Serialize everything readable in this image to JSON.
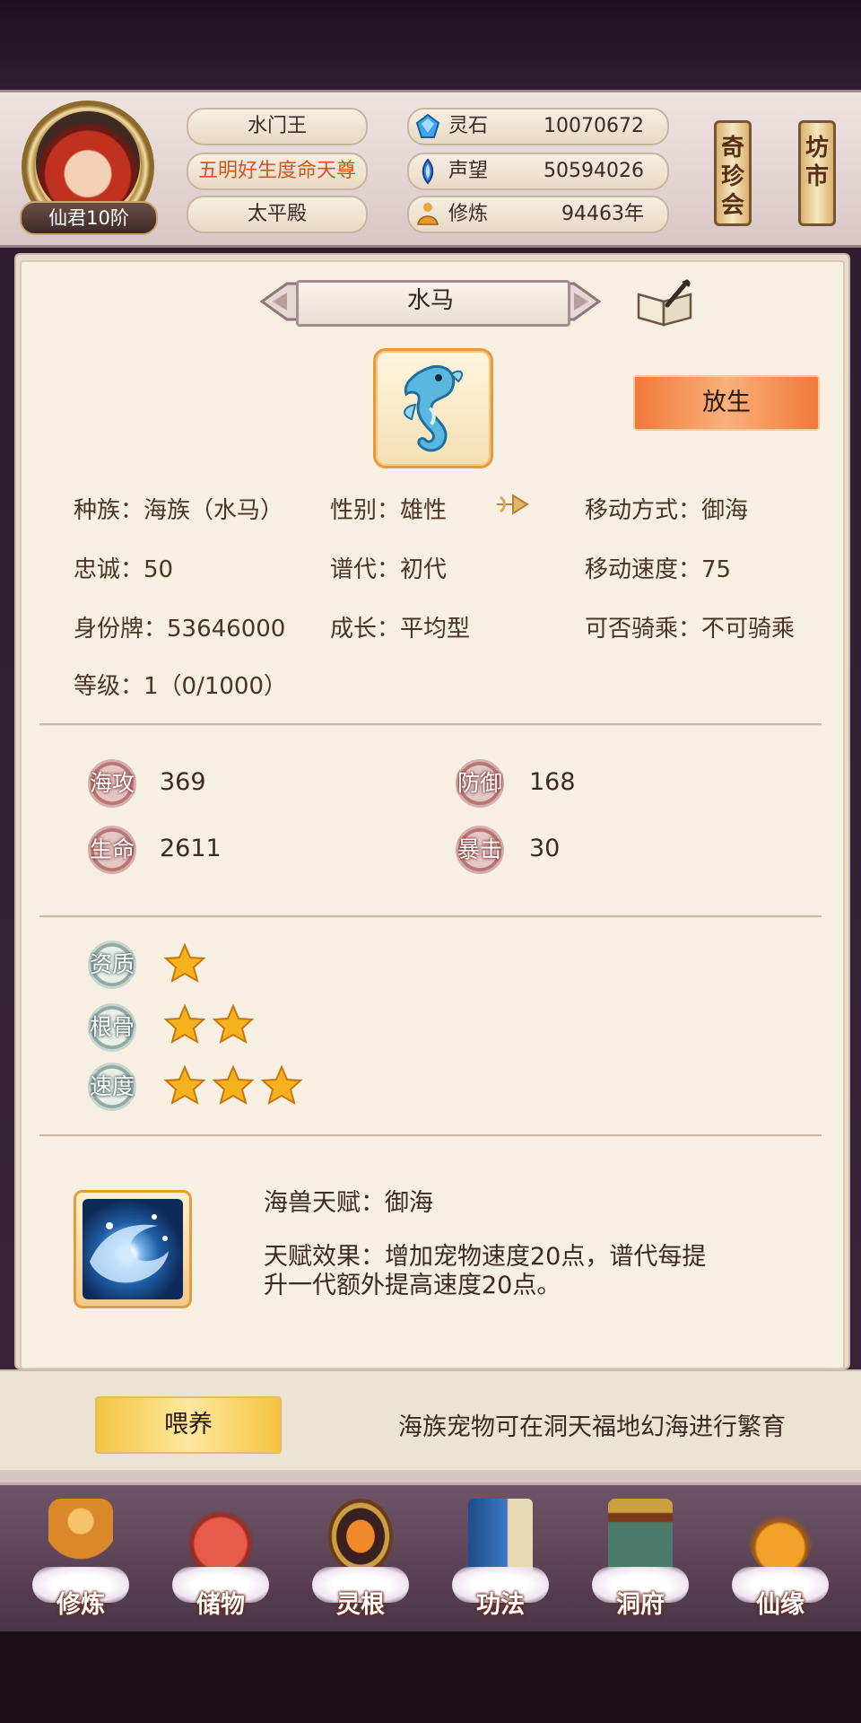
{
  "header": {
    "rank": "仙君10阶",
    "player_name": "水门王",
    "title": "五明好生度命天尊",
    "hall": "太平殿",
    "resources": [
      {
        "icon": "spirit-stone-icon",
        "label": "灵石",
        "value": "10070672"
      },
      {
        "icon": "prestige-icon",
        "label": "声望",
        "value": "50594026"
      },
      {
        "icon": "cultivation-icon",
        "label": "修炼",
        "value": "94463年"
      }
    ],
    "scrolls": [
      {
        "label": "奇珍会"
      },
      {
        "label": "坊市"
      }
    ]
  },
  "pet": {
    "name": "水马",
    "release_label": "放生",
    "fields": {
      "race": "种族：海族（水马）",
      "gender": "性别：雄性",
      "move_type": "移动方式：御海",
      "loyalty": "忠诚：50",
      "generation": "谱代：初代",
      "move_speed": "移动速度：75",
      "id_tag": "身份牌：53646000",
      "growth": "成长：平均型",
      "rideable": "可否骑乘：不可骑乘",
      "level": "等级：1（0/1000）"
    },
    "stats": [
      {
        "label": "海攻",
        "value": "369"
      },
      {
        "label": "防御",
        "value": "168"
      },
      {
        "label": "生命",
        "value": "2611"
      },
      {
        "label": "暴击",
        "value": "30"
      }
    ],
    "ratings": [
      {
        "label": "资质",
        "stars": 1
      },
      {
        "label": "根骨",
        "stars": 2
      },
      {
        "label": "速度",
        "stars": 3
      }
    ],
    "talent": {
      "name": "海兽天赋：御海",
      "effect_line1": "天赋效果：增加宠物速度20点，谱代每提",
      "effect_line2": "升一代额外提高速度20点。"
    }
  },
  "footer": {
    "feed_label": "喂养",
    "hint": "海族宠物可在洞天福地幻海进行繁育"
  },
  "nav": [
    {
      "label": "修炼",
      "icon": "meditating-monk-icon"
    },
    {
      "label": "储物",
      "icon": "treasure-bag-icon"
    },
    {
      "label": "灵根",
      "icon": "spirit-root-icon"
    },
    {
      "label": "功法",
      "icon": "scripture-book-icon"
    },
    {
      "label": "洞府",
      "icon": "cave-palace-icon"
    },
    {
      "label": "仙缘",
      "icon": "gourd-icon"
    }
  ],
  "colors": {
    "accent_orange": "#f07a3c",
    "feed_yellow": "#f5c440",
    "title_orange": "#d2541e",
    "panel_bg": "#f7f0e2"
  }
}
